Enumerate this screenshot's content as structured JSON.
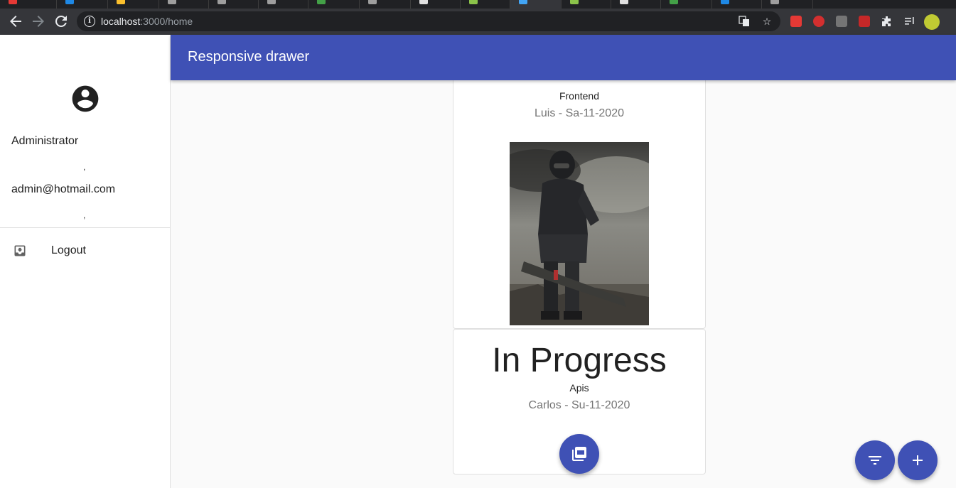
{
  "browser": {
    "url_host": "localhost",
    "url_path": ":3000/home",
    "accent_tab_colors": [
      "#e53935",
      "#1e88e5",
      "#fbc02d",
      "#9e9e9e",
      "#9e9e9e",
      "#9e9e9e",
      "#43a047",
      "#9e9e9e",
      "#8bc34a",
      "#42a5f5",
      "#8bc34a",
      "#e0e0e0",
      "#43a047",
      "#1e88e5",
      "#9e9e9e",
      "#e53935"
    ]
  },
  "appbar": {
    "title": "Responsive drawer",
    "color": "#3f51b5"
  },
  "drawer": {
    "avatar_icon": "account-circle-icon",
    "name": "Administrator",
    "separator_1": ",",
    "email": "admin@hotmail.com",
    "separator_2": ",",
    "logout_label": "Logout",
    "logout_icon": "move-to-inbox-icon"
  },
  "cards": [
    {
      "category": "Frontend",
      "meta": "Luis - Sa-11-2020",
      "image": "armored-soldier-illustration"
    },
    {
      "status": "In Progress",
      "category": "Apis",
      "meta": "Carlos - Su-11-2020",
      "action_icon": "picture-as-pdf-icon"
    }
  ],
  "fabs": [
    {
      "name": "filter",
      "icon": "filter-list-icon"
    },
    {
      "name": "add",
      "icon": "add-icon"
    }
  ]
}
